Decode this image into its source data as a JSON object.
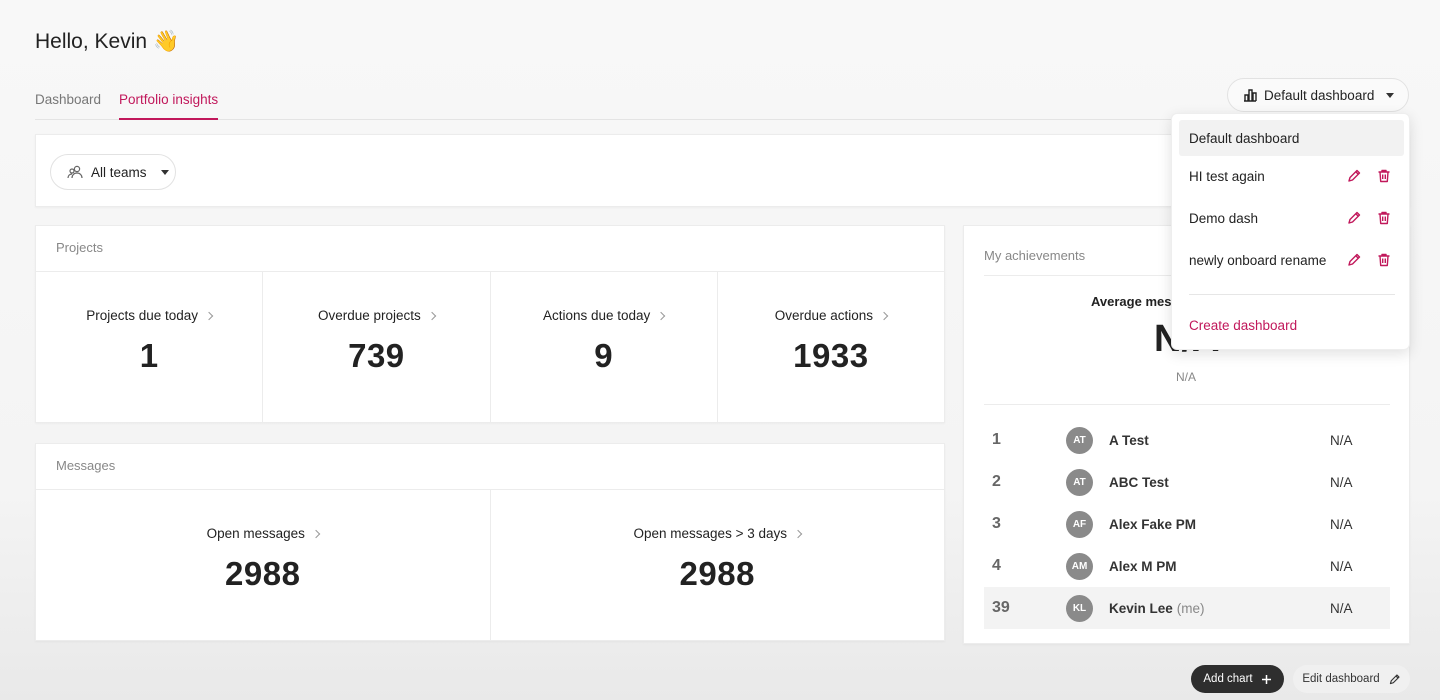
{
  "greeting": {
    "text": "Hello, Kevin",
    "emoji": "👋"
  },
  "tabs": [
    {
      "label": "Dashboard",
      "active": false
    },
    {
      "label": "Portfolio insights",
      "active": true
    }
  ],
  "dashboard_selector": {
    "label": "Default dashboard",
    "icon": "bar-chart-icon"
  },
  "filter": {
    "team_label": "All teams",
    "icon": "team-icon"
  },
  "projects": {
    "title": "Projects",
    "stats": [
      {
        "label": "Projects due today",
        "value": "1"
      },
      {
        "label": "Overdue projects",
        "value": "739"
      },
      {
        "label": "Actions due today",
        "value": "9"
      },
      {
        "label": "Overdue actions",
        "value": "1933"
      }
    ]
  },
  "messages": {
    "title": "Messages",
    "stats": [
      {
        "label": "Open messages",
        "value": "2988"
      },
      {
        "label": "Open messages > 3 days",
        "value": "2988"
      }
    ]
  },
  "achievements": {
    "title": "My achievements",
    "avg_label": "Average mess",
    "avg_value": "N/A",
    "avg_sub": "N/A",
    "ranking": [
      {
        "rank": "1",
        "initials": "AT",
        "name": "A Test",
        "value": "N/A",
        "me": false
      },
      {
        "rank": "2",
        "initials": "AT",
        "name": "ABC Test",
        "value": "N/A",
        "me": false
      },
      {
        "rank": "3",
        "initials": "AF",
        "name": "Alex Fake PM",
        "value": "N/A",
        "me": false
      },
      {
        "rank": "4",
        "initials": "AM",
        "name": "Alex M PM",
        "value": "N/A",
        "me": false
      },
      {
        "rank": "39",
        "initials": "KL",
        "name": "Kevin Lee",
        "value": "N/A",
        "me": true,
        "me_tag": "(me)"
      }
    ]
  },
  "dashboard_menu": {
    "items": [
      {
        "label": "Default dashboard",
        "selected": true,
        "editable": false
      },
      {
        "label": "HI test again",
        "selected": false,
        "editable": true
      },
      {
        "label": "Demo dash",
        "selected": false,
        "editable": true
      },
      {
        "label": "newly onboard rename",
        "selected": false,
        "editable": true
      }
    ],
    "create_label": "Create dashboard"
  },
  "footer": {
    "add_chart_label": "Add chart",
    "edit_dashboard_label": "Edit dashboard"
  },
  "colors": {
    "accent": "#c1185b",
    "dark_button": "#2e2e2e",
    "avatar": "#8a8a8a"
  }
}
